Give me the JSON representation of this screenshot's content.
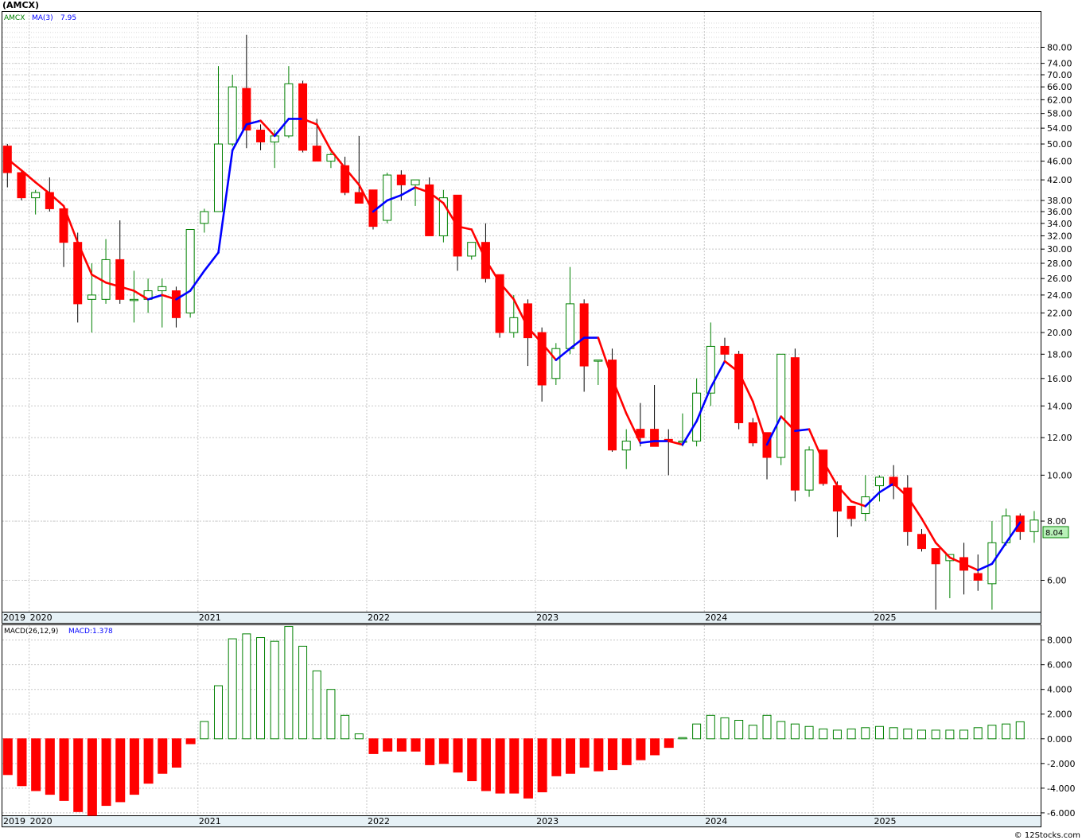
{
  "header": {
    "symbol_label": "(AMCX)"
  },
  "price_panel": {
    "legend_symbol": "AMCX",
    "legend_ma": "MA(3)",
    "legend_ma_value": "7.95",
    "last_price_label": "8.04",
    "y_ticks": [
      "80.00",
      "74.00",
      "70.00",
      "66.00",
      "62.00",
      "58.00",
      "54.00",
      "50.00",
      "46.00",
      "42.00",
      "38.00",
      "36.00",
      "34.00",
      "32.00",
      "30.00",
      "28.00",
      "26.00",
      "24.00",
      "22.00",
      "20.00",
      "18.00",
      "16.00",
      "14.00",
      "12.00",
      "10.00",
      "8.00",
      "6.00"
    ]
  },
  "macd_panel": {
    "legend_macd": "MACD(26,12,9)",
    "legend_macd_value": "MACD:1.378",
    "y_ticks": [
      "8.000",
      "6.000",
      "4.000",
      "2.000",
      "0.000",
      "-2.000",
      "-4.000",
      "-6.000"
    ]
  },
  "x_ticks": [
    "2019",
    "2020",
    "2021",
    "2022",
    "2023",
    "2024",
    "2025"
  ],
  "footer": {
    "watermark": "© 12Stocks.com"
  },
  "colors": {
    "up": "#008000",
    "down": "#ff0000",
    "ma_up": "#0000ff",
    "ma_down": "#ff0000",
    "grid": "#c8c8c8"
  },
  "chart_data": {
    "type": "candlestick",
    "scale": "log",
    "ylim": [
      5.15,
      95
    ],
    "months": [
      "2019-11",
      "2019-12",
      "2020-01",
      "2020-02",
      "2020-03",
      "2020-04",
      "2020-05",
      "2020-06",
      "2020-07",
      "2020-08",
      "2020-09",
      "2020-10",
      "2020-11",
      "2020-12",
      "2021-01",
      "2021-02",
      "2021-03",
      "2021-04",
      "2021-05",
      "2021-06",
      "2021-07",
      "2021-08",
      "2021-09",
      "2021-10",
      "2021-11",
      "2021-12",
      "2022-01",
      "2022-02",
      "2022-03",
      "2022-04",
      "2022-05",
      "2022-06",
      "2022-07",
      "2022-08",
      "2022-09",
      "2022-10",
      "2022-11",
      "2022-12",
      "2023-01",
      "2023-02",
      "2023-03",
      "2023-04",
      "2023-05",
      "2023-06",
      "2023-07",
      "2023-08",
      "2023-09",
      "2023-10",
      "2023-11",
      "2023-12",
      "2024-01",
      "2024-02",
      "2024-03",
      "2024-04",
      "2024-05",
      "2024-06",
      "2024-07",
      "2024-08",
      "2024-09",
      "2024-10",
      "2024-11",
      "2024-12",
      "2025-01",
      "2025-02",
      "2025-03",
      "2025-04",
      "2025-05",
      "2025-06",
      "2025-07",
      "2025-08",
      "2025-09",
      "2025-10",
      "2025-11"
    ],
    "ohlc": [
      [
        49.5,
        50,
        40.5,
        43.5
      ],
      [
        43.5,
        44,
        38,
        38.5
      ],
      [
        38.5,
        40,
        35.5,
        39.5
      ],
      [
        39.5,
        42.5,
        36,
        36.5
      ],
      [
        36.5,
        37,
        27.5,
        31
      ],
      [
        31,
        32.5,
        21,
        23
      ],
      [
        23.5,
        28,
        20,
        24
      ],
      [
        23.5,
        31.5,
        23,
        28.5
      ],
      [
        28.5,
        34.5,
        23,
        23.5
      ],
      [
        23.5,
        27,
        21,
        23.5
      ],
      [
        23.5,
        26,
        22,
        24.5
      ],
      [
        24.5,
        26,
        20.5,
        25
      ],
      [
        24.5,
        25,
        20.5,
        21.5
      ],
      [
        22,
        33,
        21.5,
        33
      ],
      [
        34,
        36.5,
        32.5,
        36
      ],
      [
        36,
        73,
        36,
        50
      ],
      [
        50,
        70,
        49.5,
        66
      ],
      [
        65.5,
        85,
        49,
        53.5
      ],
      [
        53.5,
        55,
        48.5,
        50.5
      ],
      [
        50.5,
        53.5,
        44.5,
        52
      ],
      [
        52,
        73,
        51.5,
        67
      ],
      [
        67,
        68,
        48,
        48.5
      ],
      [
        49.5,
        56.5,
        46,
        46
      ],
      [
        46,
        48,
        44.5,
        47.5
      ],
      [
        45,
        47,
        39,
        39.5
      ],
      [
        39.5,
        52,
        38.5,
        37.5
      ],
      [
        40,
        40,
        33,
        33.5
      ],
      [
        34.5,
        43.5,
        34,
        43
      ],
      [
        43,
        44,
        38,
        41
      ],
      [
        41,
        41.5,
        37,
        42
      ],
      [
        41,
        42.5,
        32,
        32
      ],
      [
        32,
        40,
        31,
        38.5
      ],
      [
        39,
        39,
        27,
        29
      ],
      [
        29,
        30,
        28.5,
        31
      ],
      [
        31,
        34,
        25.5,
        26
      ],
      [
        26.5,
        26.5,
        19.5,
        20
      ],
      [
        20,
        24,
        19.5,
        21.5
      ],
      [
        23,
        23.5,
        17,
        19.5
      ],
      [
        20,
        20.5,
        14.3,
        15.5
      ],
      [
        16,
        19,
        15.5,
        18.5
      ],
      [
        18.5,
        27.5,
        18,
        23
      ],
      [
        23,
        23.5,
        15,
        17
      ],
      [
        17.5,
        17.5,
        15.5,
        17.5
      ],
      [
        17.5,
        18.5,
        11.2,
        11.3
      ],
      [
        11.3,
        12.5,
        10.3,
        11.8
      ],
      [
        12.5,
        14.2,
        11.5,
        12
      ],
      [
        12.5,
        15.5,
        11.5,
        11.5
      ],
      [
        11.9,
        12.5,
        10,
        11.8
      ],
      [
        11.8,
        13.5,
        11.5,
        11.8
      ],
      [
        11.8,
        16,
        11.5,
        14.9
      ],
      [
        14.9,
        21,
        14,
        18.7
      ],
      [
        18.7,
        19.5,
        17.5,
        18
      ],
      [
        18,
        18.3,
        12.5,
        12.9
      ],
      [
        12.9,
        13.2,
        11.5,
        11.7
      ],
      [
        12.3,
        12.3,
        9.8,
        10.9
      ],
      [
        10.9,
        18,
        10.5,
        18
      ],
      [
        17.7,
        18.5,
        8.8,
        9.3
      ],
      [
        9.3,
        11.5,
        9,
        11.3
      ],
      [
        11.3,
        11.3,
        9.5,
        9.6
      ],
      [
        9.5,
        9.7,
        7.4,
        8.4
      ],
      [
        8.6,
        8.6,
        7.8,
        8.1
      ],
      [
        8.3,
        10,
        8,
        9
      ],
      [
        9.5,
        10,
        8.8,
        9.9
      ],
      [
        9.9,
        10.5,
        8.9,
        9.5
      ],
      [
        9.4,
        10,
        7.1,
        7.6
      ],
      [
        7.5,
        7.7,
        6.9,
        7
      ],
      [
        7,
        7,
        5.2,
        6.5
      ],
      [
        6.6,
        6.8,
        5.5,
        6.8
      ],
      [
        6.7,
        7.2,
        5.6,
        6.3
      ],
      [
        6.2,
        6.8,
        5.7,
        6
      ],
      [
        5.9,
        8,
        5.2,
        7.2
      ],
      [
        7.2,
        8.5,
        7.1,
        8.2
      ],
      [
        8.2,
        8.3,
        7.3,
        7.6
      ],
      [
        7.6,
        8.4,
        7.2,
        8.04
      ]
    ],
    "ma3": [
      46.5,
      44,
      41.5,
      39.3,
      37,
      31,
      26.5,
      25.5,
      25,
      24.5,
      23.5,
      24,
      23.5,
      24.5,
      27,
      29.5,
      48.5,
      55,
      56,
      52,
      56.5,
      56.5,
      55,
      48.5,
      44.5,
      41,
      36,
      38,
      39,
      40.5,
      39.5,
      37.5,
      33.5,
      33,
      28.5,
      25.5,
      23.5,
      20.5,
      19,
      17.5,
      18.5,
      19.5,
      19.5,
      16,
      13.5,
      11.7,
      11.8,
      11.8,
      11.6,
      13,
      15.3,
      17.4,
      16.5,
      14.3,
      11.6,
      13.3,
      12.4,
      12.5,
      10.7,
      9.5,
      8.8,
      8.6,
      9.2,
      9.6,
      9,
      8.1,
      7.2,
      6.7,
      6.5,
      6.3,
      6.5,
      7.2,
      7.95
    ],
    "macd_hist": [
      -2.9,
      -3.8,
      -4.2,
      -4.5,
      -5,
      -5.9,
      -6.2,
      -5.4,
      -5.1,
      -4.5,
      -3.6,
      -2.8,
      -2.3,
      -0.4,
      1.4,
      4.3,
      8.1,
      8.5,
      8.2,
      7.9,
      9.1,
      7.5,
      5.5,
      4,
      1.9,
      0.4,
      -1.2,
      -1.0,
      -1.0,
      -1.0,
      -2.1,
      -2.0,
      -2.7,
      -3.4,
      -4.2,
      -4.4,
      -4.4,
      -4.8,
      -4.3,
      -3.0,
      -2.8,
      -2.3,
      -2.6,
      -2.5,
      -2.1,
      -1.7,
      -1.3,
      -0.7,
      0.1,
      1.2,
      1.9,
      1.7,
      1.5,
      1.1,
      1.9,
      1.4,
      1.2,
      1.0,
      0.8,
      0.7,
      0.8,
      0.9,
      1.0,
      0.9,
      0.8,
      0.7,
      0.7,
      0.7,
      0.7,
      0.9,
      1.1,
      1.2,
      1.378
    ]
  }
}
